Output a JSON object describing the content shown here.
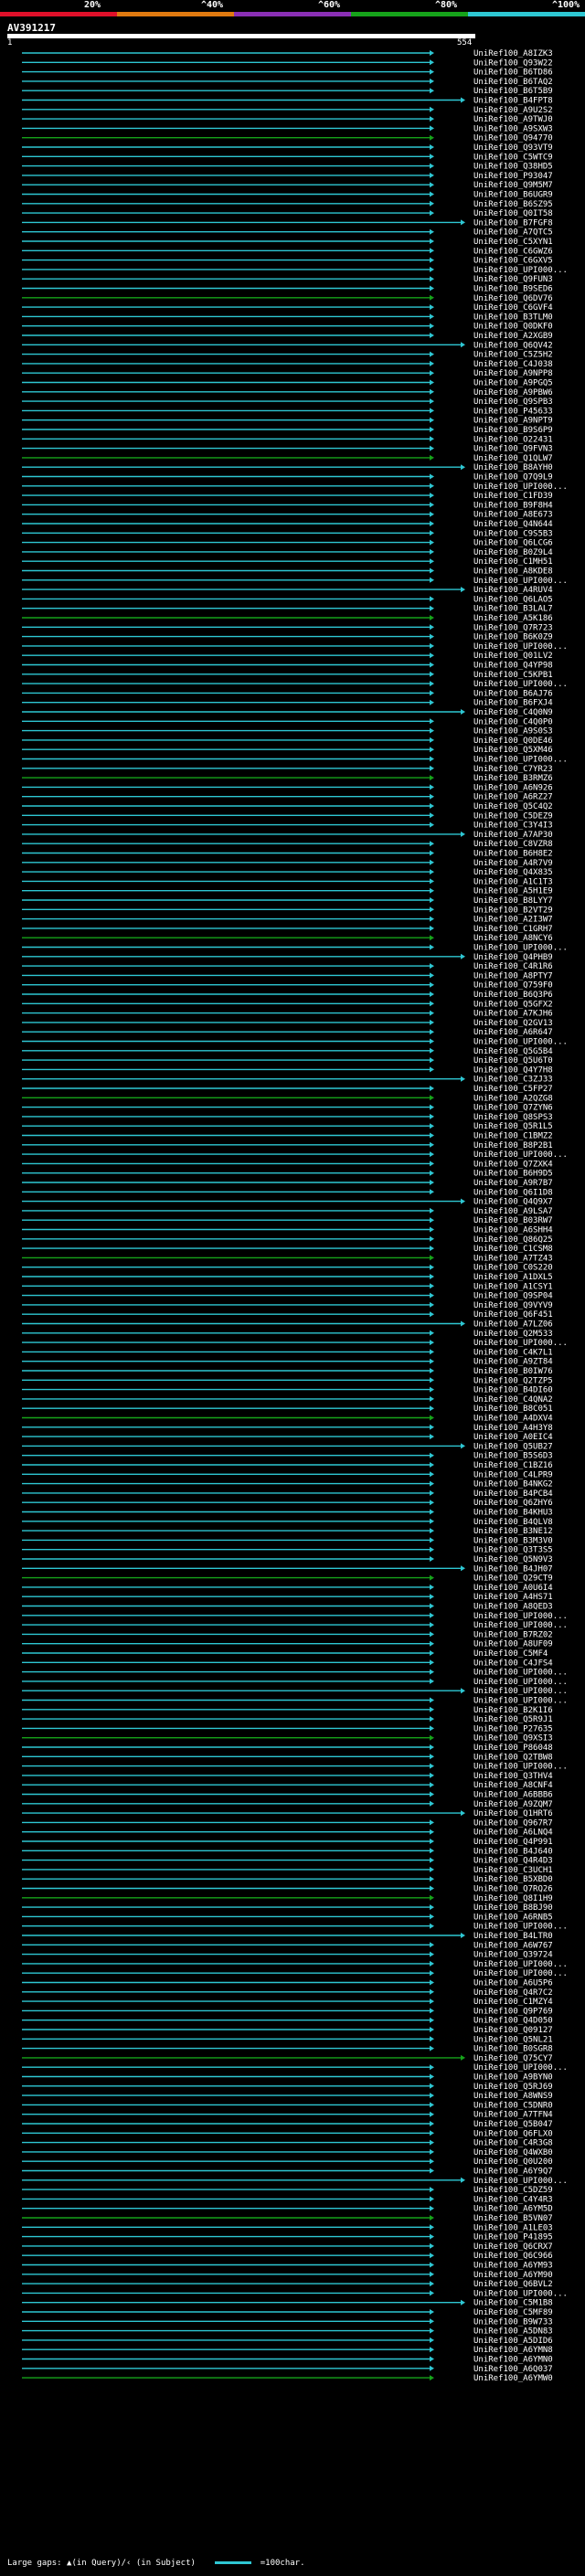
{
  "scale": {
    "ticks": [
      "20%",
      "^40%",
      "^60%",
      "^80%",
      "^100%"
    ],
    "colors": [
      "#e0102a",
      "#e07a10",
      "#8a2fb5",
      "#16a31a",
      "#2ec7d3"
    ]
  },
  "query": {
    "id": "AV391217",
    "start": "1",
    "end": "554"
  },
  "chart_data": {
    "type": "bar",
    "query_length": 554,
    "query_start": 1,
    "x_unit": "query position",
    "hits": [
      "UniRef100_A8IZK3",
      "UniRef100_Q93W22",
      "UniRef100_B6TD86",
      "UniRef100_B6TAQ2",
      "UniRef100_B6T5B9",
      "UniRef100_B4FPT8",
      "UniRef100_A9U2S2",
      "UniRef100_A9TWJ0",
      "UniRef100_A9SXW3",
      "UniRef100_Q94770",
      "UniRef100_Q93VT9",
      "UniRef100_C5WTC9",
      "UniRef100_Q38HD5",
      "UniRef100_P93047",
      "UniRef100_Q9M5M7",
      "UniRef100_B6UGR9",
      "UniRef100_B6SZ95",
      "UniRef100_Q0IT58",
      "UniRef100_B7FGF8",
      "UniRef100_A7QTC5",
      "UniRef100_C5XYN1",
      "UniRef100_C6GWZ6",
      "UniRef100_C6GXV5",
      "UniRef100_UPI000...",
      "UniRef100_Q9FUN3",
      "UniRef100_B9SED6",
      "UniRef100_Q6DV76",
      "UniRef100_C6GVF4",
      "UniRef100_B3TLM0",
      "UniRef100_Q0DKF0",
      "UniRef100_A2XGB9",
      "UniRef100_Q6QV42",
      "UniRef100_C5Z5H2",
      "UniRef100_C4J038",
      "UniRef100_A9NPP8",
      "UniRef100_A9PGQ5",
      "UniRef100_A9PBW6",
      "UniRef100_Q9SPB3",
      "UniRef100_P45633",
      "UniRef100_A9NPT9",
      "UniRef100_B9S6P9",
      "UniRef100_O22431",
      "UniRef100_Q9FVN3",
      "UniRef100_Q1QLW7",
      "UniRef100_B8AYH0",
      "UniRef100_Q7Q9L9",
      "UniRef100_UPI000...",
      "UniRef100_C1FD39",
      "UniRef100_B9F8H4",
      "UniRef100_A8E673",
      "UniRef100_Q4N644",
      "UniRef100_C9S5B3",
      "UniRef100_Q6LCG6",
      "UniRef100_B0Z9L4",
      "UniRef100_C1MH51",
      "UniRef100_A8KDE8",
      "UniRef100_UPI000...",
      "UniRef100_A4RUV4",
      "UniRef100_Q6LAO5",
      "UniRef100_B3LAL7",
      "UniRef100_A5K186",
      "UniRef100_Q7R723",
      "UniRef100_B6K0Z9",
      "UniRef100_UPI000...",
      "UniRef100_Q01LV2",
      "UniRef100_Q4YP98",
      "UniRef100_C5KPB1",
      "UniRef100_UPI000...",
      "UniRef100_B6AJ76",
      "UniRef100_B6FXJ4",
      "UniRef100_C4Q0N9",
      "UniRef100_C4Q0P0",
      "UniRef100_A9S0S3",
      "UniRef100_Q0DE46",
      "UniRef100_Q5XM46",
      "UniRef100_UPI000...",
      "UniRef100_C7YR23",
      "UniRef100_B3RMZ6",
      "UniRef100_A6N926",
      "UniRef100_A6RZ27",
      "UniRef100_Q5C4Q2",
      "UniRef100_C5DEZ9",
      "UniRef100_C3Y4I3",
      "UniRef100_A7AP30",
      "UniRef100_C8VZR8",
      "UniRef100_B6H8E2",
      "UniRef100_A4R7V9",
      "UniRef100_Q4X835",
      "UniRef100_A1C1T3",
      "UniRef100_A5H1E9",
      "UniRef100_B8LYY7",
      "UniRef100_B2VT29",
      "UniRef100_A2I3W7",
      "UniRef100_C1GRH7",
      "UniRef100_A8NCY6",
      "UniRef100_UPI000...",
      "UniRef100_Q4PHB9",
      "UniRef100_C4R1R6",
      "UniRef100_A8PTY7",
      "UniRef100_Q759F0",
      "UniRef100_B6Q3P6",
      "UniRef100_Q5GFX2",
      "UniRef100_A7KJH6",
      "UniRef100_Q2GV13",
      "UniRef100_A6R647",
      "UniRef100_UPI000...",
      "UniRef100_Q5G5B4",
      "UniRef100_Q5U6T0",
      "UniRef100_Q4Y7H8",
      "UniRef100_C3ZJ33",
      "UniRef100_C5FP27",
      "UniRef100_A2QZG8",
      "UniRef100_Q7ZYN6",
      "UniRef100_Q8SPS3",
      "UniRef100_Q5R1L5",
      "UniRef100_C1BMZ2",
      "UniRef100_B8P2B1",
      "UniRef100_UPI000...",
      "UniRef100_Q7ZXK4",
      "UniRef100_B6H9D5",
      "UniRef100_A9R7B7",
      "UniRef100_Q6I1D8",
      "UniRef100_Q4Q9X7",
      "UniRef100_A9LSA7",
      "UniRef100_B03RW7",
      "UniRef100_A6SHH4",
      "UniRef100_Q86Q25",
      "UniRef100_C1CSM8",
      "UniRef100_A7TZ43",
      "UniRef100_C0S220",
      "UniRef100_A1DXL5",
      "UniRef100_A1CSY1",
      "UniRef100_Q9SP04",
      "UniRef100_Q9VYV9",
      "UniRef100_Q6F451",
      "UniRef100_A7LZ06",
      "UniRef100_Q2M533",
      "UniRef100_UPI000...",
      "UniRef100_C4K7L1",
      "UniRef100_A9ZT84",
      "UniRef100_B0IW76",
      "UniRef100_Q2TZP5",
      "UniRef100_B4DI60",
      "UniRef100_C4QNA2",
      "UniRef100_B8C051",
      "UniRef100_A4DXV4",
      "UniRef100_A4H3Y8",
      "UniRef100_A0EIC4",
      "UniRef100_Q5UB27",
      "UniRef100_B5S6D3",
      "UniRef100_C1BZ16",
      "UniRef100_C4LPR9",
      "UniRef100_B4NKG2",
      "UniRef100_B4PCB4",
      "UniRef100_Q6ZHY6",
      "UniRef100_B4KHU3",
      "UniRef100_B4QLV8",
      "UniRef100_B3NE12",
      "UniRef100_B3M3V0",
      "UniRef100_Q3T3S5",
      "UniRef100_Q5N9V3",
      "UniRef100_B4JH07",
      "UniRef100_Q29CT9",
      "UniRef100_A0U6I4",
      "UniRef100_A4HS71",
      "UniRef100_A8QED3",
      "UniRef100_UPI000...",
      "UniRef100_UPI000...",
      "UniRef100_B7RZ02",
      "UniRef100_A8UF09",
      "UniRef100_C5MF4",
      "UniRef100_C4JFS4",
      "UniRef100_UPI000...",
      "UniRef100_UPI000...",
      "UniRef100_UPI000...",
      "UniRef100_UPI000...",
      "UniRef100_B2K1I6",
      "UniRef100_Q5R9J1",
      "UniRef100_P27635",
      "UniRef100_Q9XSI3",
      "UniRef100_P86048",
      "UniRef100_Q2TBW8",
      "UniRef100_UPI000...",
      "UniRef100_Q3THV4",
      "UniRef100_A8CNF4",
      "UniRef100_A6BBB6",
      "UniRef100_A9ZQM7",
      "UniRef100_Q1HRT6",
      "UniRef100_Q967R7",
      "UniRef100_A6LNQ4",
      "UniRef100_Q4P991",
      "UniRef100_B4J640",
      "UniRef100_Q4R4D3",
      "UniRef100_C3UCH1",
      "UniRef100_B5XBD0",
      "UniRef100_Q7RQ26",
      "UniRef100_Q8I1H9",
      "UniRef100_B8BJ90",
      "UniRef100_A6RNB5",
      "UniRef100_UPI000...",
      "UniRef100_B4LTR0",
      "UniRef100_A6W767",
      "UniRef100_Q39724",
      "UniRef100_UPI000...",
      "UniRef100_UPI000...",
      "UniRef100_A6U5P6",
      "UniRef100_Q4R7C2",
      "UniRef100_C1MZY4",
      "UniRef100_Q9P769",
      "UniRef100_Q4D050",
      "UniRef100_Q09127",
      "UniRef100_Q5NL21",
      "UniRef100_B0SGR8",
      "UniRef100_Q75CY7",
      "UniRef100_UPI000...",
      "UniRef100_A9BYN0",
      "UniRef100_Q5RJ69",
      "UniRef100_A8WNS9",
      "UniRef100_C5DNR0",
      "UniRef100_A7TFN4",
      "UniRef100_Q5B047",
      "UniRef100_Q6FLX0",
      "UniRef100_C4R3G8",
      "UniRef100_Q4WXB0",
      "UniRef100_Q0U200",
      "UniRef100_A6Y9Q7",
      "UniRef100_UPI000...",
      "UniRef100_C5DZ59",
      "UniRef100_C4Y4R3",
      "UniRef100_A6YM5D",
      "UniRef100_B5VN07",
      "UniRef100_A1LE03",
      "UniRef100_P41895",
      "UniRef100_Q6CRX7",
      "UniRef100_Q6C966",
      "UniRef100_A6YM93",
      "UniRef100_A6YM90",
      "UniRef100_Q6BVL2",
      "UniRef100_UPI000...",
      "UniRef100_C5M1B8",
      "UniRef100_C5MF89",
      "UniRef100_B9W733",
      "UniRef100_A5DN83",
      "UniRef100_A5DID6",
      "UniRef100_A6YMN8",
      "UniRef100_A6YMN0",
      "UniRef100_A6Q037",
      "UniRef100_A6YMW0"
    ]
  },
  "footer": {
    "gaps_text": "Large gaps: ▲(in Query)/‹ (in Subject)",
    "legend_text": "=100char."
  }
}
